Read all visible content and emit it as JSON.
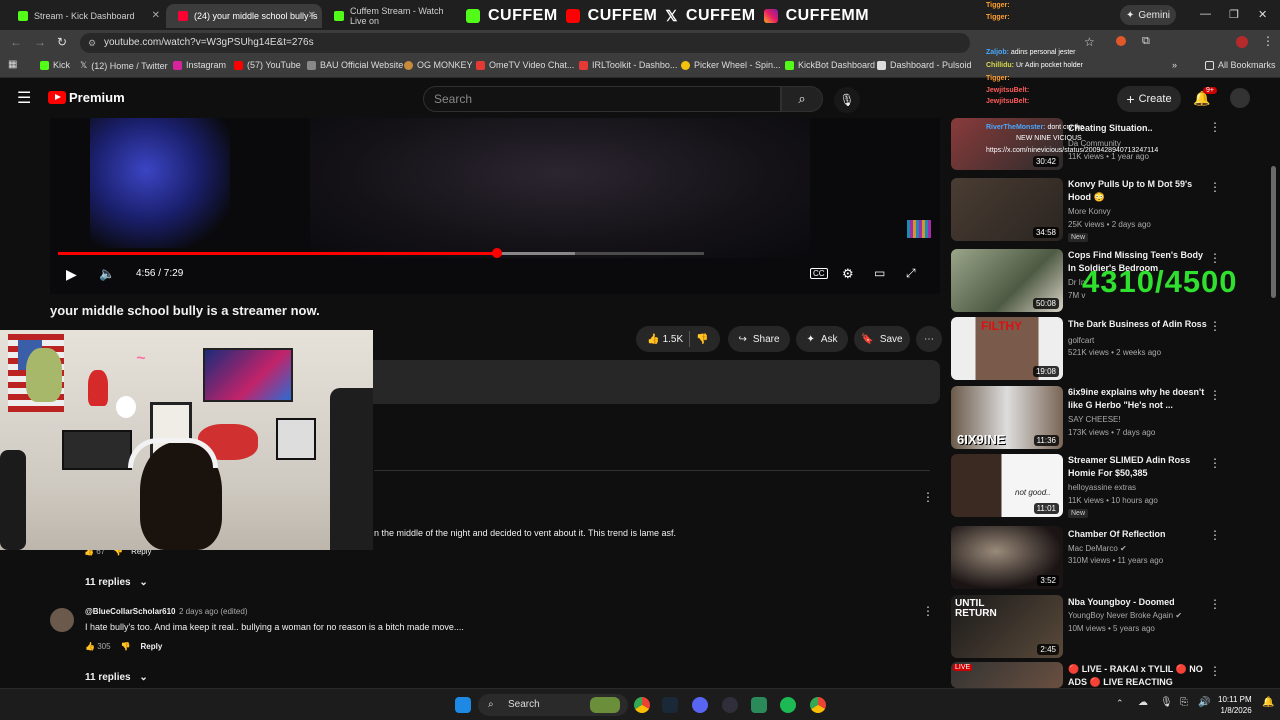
{
  "tabs": [
    {
      "label": "Stream - Kick Dashboard"
    },
    {
      "label": "(24) your middle school bully is"
    },
    {
      "label": "Cuffem Stream - Watch Live on"
    }
  ],
  "overlay_banner": [
    "CUFFEM",
    "CUFFEM",
    "CUFFEM",
    "CUFFEMM"
  ],
  "gemini_label": "Gemini",
  "url": "youtube.com/watch?v=W3gPSUhg14E&t=276s",
  "bookmarks": [
    "Kick",
    "(12) Home / Twitter",
    "Instagram",
    "(57) YouTube",
    "BAU Official Website",
    "OG MONKEY",
    "OmeTV Video Chat...",
    "IRLToolkit - Dashbo...",
    "Picker Wheel - Spin...",
    "KickBot Dashboard",
    "Dashboard - Pulsoid",
    "All Bookmarks"
  ],
  "yt": {
    "logo_text": "Premium",
    "search_placeholder": "Search",
    "create_label": "Create",
    "notif_badge": "9+"
  },
  "player": {
    "time": "4:56 / 7:29",
    "progress": 0.68,
    "buffered": 0.8
  },
  "video_title": "your middle school bully is a streamer now.",
  "actions": {
    "likes": "1.5K",
    "share": "Share",
    "ask": "Ask",
    "save": "Save"
  },
  "comments": [
    {
      "text": "n the middle of the night and decided to vent about it. This trend is lame asf.",
      "likes": "67",
      "reply": "Reply",
      "replies": "11 replies"
    },
    {
      "author": "@BlueCollarScholar610",
      "time": "2 days ago (edited)",
      "text": "I hate bully's too. And ima keep it real.. bullying a woman for no reason is a bitch made move....",
      "likes": "305",
      "reply": "Reply",
      "replies": "11 replies"
    }
  ],
  "recommendations": [
    {
      "title": "Cheating Situation..",
      "channel": "Da Community",
      "views": "11K views • 1 year ago",
      "duration": "30:42"
    },
    {
      "title": "Konvy Pulls Up to M Dot 59's Hood 😳",
      "channel": "More Konvy",
      "views": "25K views • 2 days ago",
      "duration": "34:58",
      "badge": "New"
    },
    {
      "title": "Cops Find Missing Teen's Body In Soldier's Bedroom",
      "channel": "Dr In",
      "views": "7M v",
      "duration": "50:08"
    },
    {
      "title": "The Dark Business of Adin Ross",
      "channel": "golfcart",
      "views": "521K views • 2 weeks ago",
      "duration": "19:08"
    },
    {
      "title": "6ix9ine explains why he doesn't like G Herbo \"He's not ...",
      "channel": "SAY CHEESE!",
      "views": "173K views • 7 days ago",
      "duration": "11:36"
    },
    {
      "title": "Streamer SLIMED Adin Ross Homie For $50,385",
      "channel": "helloyassine extras",
      "views": "11K views • 10 hours ago",
      "duration": "11:01",
      "badge": "New"
    },
    {
      "title": "Chamber Of Reflection",
      "channel": "Mac DeMarco",
      "views": "310M views • 11 years ago",
      "duration": "3:52"
    },
    {
      "title": "Nba Youngboy - Doomed",
      "channel": "YoungBoy Never Broke Again",
      "views": "10M views • 5 years ago",
      "duration": "2:45"
    },
    {
      "title": "🔴 LIVE - RAKAI x TYLIL 🔴 NO ADS 🔴 LIVE REACTING",
      "channel": "",
      "views": "",
      "duration": ""
    }
  ],
  "thumb_text": {
    "filthy": "FILTHY",
    "sixnine": "6IX9INE",
    "notgood": "not good..",
    "until": "UNTIL RETURN",
    "live": "LIVE"
  },
  "counter": "4310/4500",
  "chat": [
    {
      "name": "Tigger:",
      "msg": ""
    },
    {
      "name": "Tigger:",
      "msg": ""
    },
    {
      "name": "Zaljob:",
      "msg": "adins personal jester"
    },
    {
      "name": "Chillidu:",
      "msg": "Ur Adin pocket holder"
    },
    {
      "name": "Tigger:",
      "msg": ""
    },
    {
      "name": "JewjitsuBelt:",
      "msg": ""
    },
    {
      "name": "JewjitsuBelt:",
      "msg": ""
    },
    {
      "name": "RiverTheMonster:",
      "msg": "dont cry tho"
    },
    {
      "name": "",
      "msg": "NEW NINE VICIOUS"
    },
    {
      "name": "",
      "msg": "https://x.com/ninevicious/status/2009428940713247114"
    }
  ],
  "taskbar": {
    "search": "Search",
    "time": "10:11 PM",
    "date": "1/8/2026"
  }
}
